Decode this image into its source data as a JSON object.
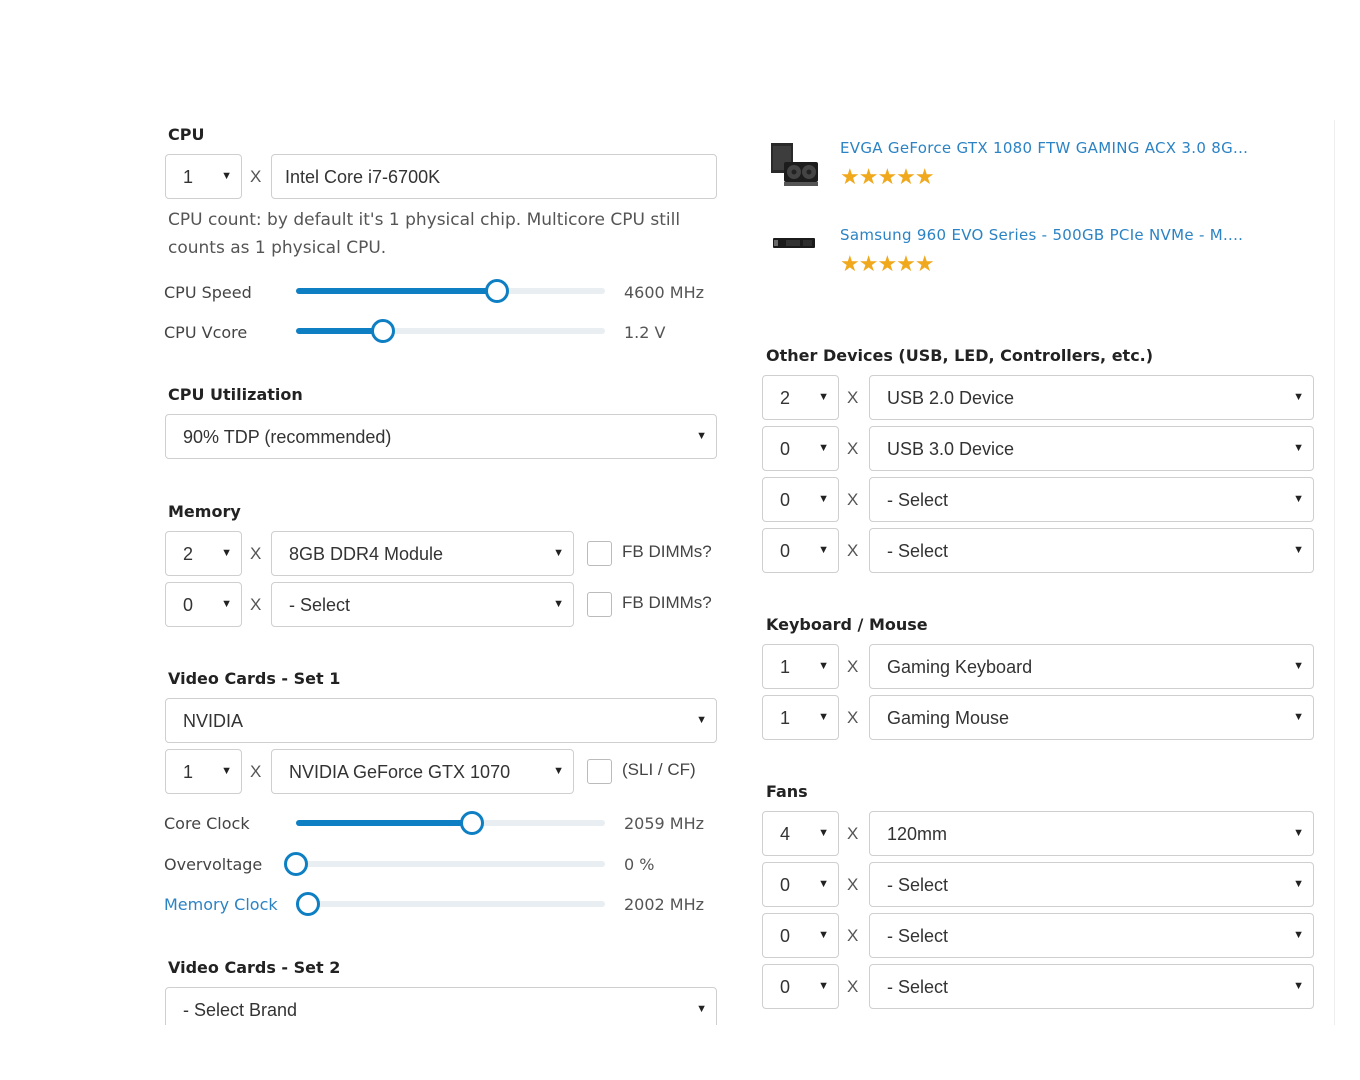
{
  "cpu": {
    "title": "CPU",
    "count": "1",
    "x": "X",
    "model": "Intel Core i7-6700K",
    "note_line1": "CPU count: by default it's 1 physical chip. Multicore CPU still",
    "note_line2": "counts as 1 physical CPU.",
    "speed": {
      "label": "CPU Speed",
      "value": "4600 MHz",
      "level": 0.65
    },
    "vcore": {
      "label": "CPU Vcore",
      "value": "1.2 V",
      "level": 0.28
    }
  },
  "cpu_utilization": {
    "title": "CPU Utilization",
    "selected": "90% TDP (recommended)"
  },
  "memory": {
    "title": "Memory",
    "rows": [
      {
        "count": "2",
        "x": "X",
        "module": "8GB DDR4 Module",
        "fb_label": "FB DIMMs?"
      },
      {
        "count": "0",
        "x": "X",
        "module": "- Select",
        "fb_label": "FB DIMMs?"
      }
    ]
  },
  "video1": {
    "title": "Video Cards - Set 1",
    "brand": "NVIDIA",
    "count": "1",
    "x": "X",
    "model": "NVIDIA GeForce GTX 1070",
    "sli_label": "(SLI / CF)",
    "core_clock": {
      "label": "Core Clock",
      "value": "2059 MHz",
      "level": 0.57
    },
    "overvoltage": {
      "label": "Overvoltage",
      "value": "0 %",
      "level": 0.0
    },
    "memory_clock": {
      "label": "Memory Clock",
      "value": "2002 MHz",
      "level": 0.04
    }
  },
  "video2": {
    "title": "Video Cards - Set 2",
    "brand": "- Select Brand"
  },
  "products": [
    {
      "name": "EVGA GeForce GTX 1080 FTW GAMING ACX 3.0 8G...",
      "rating": "★★★★★"
    },
    {
      "name": "Samsung 960 EVO Series - 500GB PCIe NVMe - M....",
      "rating": "★★★★★"
    }
  ],
  "other_devices": {
    "title": "Other Devices (USB, LED, Controllers, etc.)",
    "rows": [
      {
        "count": "2",
        "x": "X",
        "device": "USB 2.0 Device"
      },
      {
        "count": "0",
        "x": "X",
        "device": "USB 3.0 Device"
      },
      {
        "count": "0",
        "x": "X",
        "device": "- Select"
      },
      {
        "count": "0",
        "x": "X",
        "device": "- Select"
      }
    ]
  },
  "keyboard_mouse": {
    "title": "Keyboard / Mouse",
    "rows": [
      {
        "count": "1",
        "x": "X",
        "device": "Gaming Keyboard"
      },
      {
        "count": "1",
        "x": "X",
        "device": "Gaming Mouse"
      }
    ]
  },
  "fans": {
    "title": "Fans",
    "rows": [
      {
        "count": "4",
        "x": "X",
        "device": "120mm"
      },
      {
        "count": "0",
        "x": "X",
        "device": "- Select"
      },
      {
        "count": "0",
        "x": "X",
        "device": "- Select"
      },
      {
        "count": "0",
        "x": "X",
        "device": "- Select"
      }
    ]
  },
  "icons": {
    "caret": "▼"
  }
}
